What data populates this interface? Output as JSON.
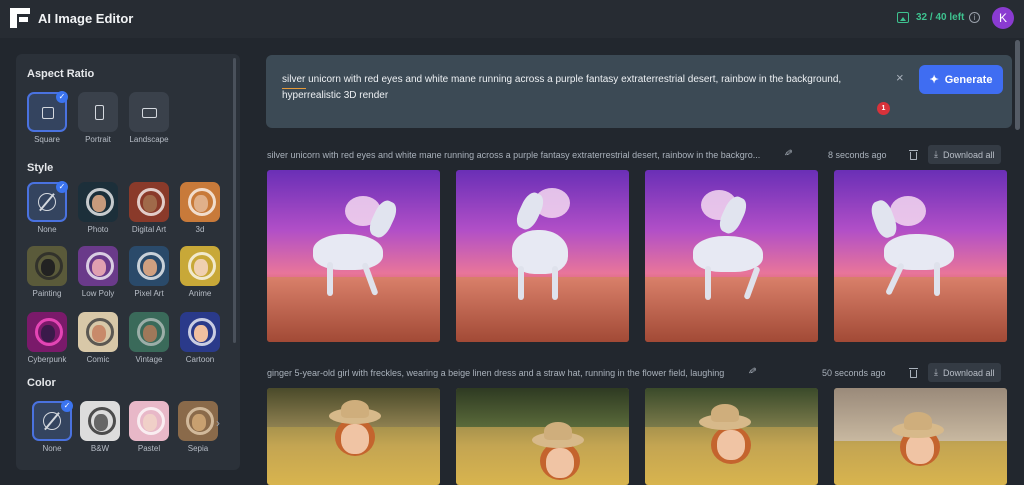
{
  "app": {
    "title": "AI Image Editor",
    "credits": "32 / 40 left",
    "avatar_initial": "K"
  },
  "sidebar": {
    "aspect_ratio": {
      "title": "Aspect Ratio",
      "options": [
        {
          "label": "Square",
          "selected": true,
          "icon": "square-icon"
        },
        {
          "label": "Portrait",
          "selected": false,
          "icon": "portrait-icon"
        },
        {
          "label": "Landscape",
          "selected": false,
          "icon": "landscape-icon"
        }
      ]
    },
    "style": {
      "title": "Style",
      "options": [
        {
          "label": "None",
          "selected": true
        },
        {
          "label": "Photo",
          "selected": false
        },
        {
          "label": "Digital Art",
          "selected": false
        },
        {
          "label": "3d",
          "selected": false
        },
        {
          "label": "Painting",
          "selected": false
        },
        {
          "label": "Low Poly",
          "selected": false
        },
        {
          "label": "Pixel Art",
          "selected": false
        },
        {
          "label": "Anime",
          "selected": false
        },
        {
          "label": "Cyberpunk",
          "selected": false
        },
        {
          "label": "Comic",
          "selected": false
        },
        {
          "label": "Vintage",
          "selected": false
        },
        {
          "label": "Cartoon",
          "selected": false
        }
      ]
    },
    "color": {
      "title": "Color",
      "options": [
        {
          "label": "None",
          "selected": true
        },
        {
          "label": "B&W",
          "selected": false
        },
        {
          "label": "Pastel",
          "selected": false
        },
        {
          "label": "Sepia",
          "selected": false
        }
      ]
    }
  },
  "prompt": {
    "text": "silver unicorn with red eyes and white mane running across a purple fantasy extraterrestrial desert, rainbow in the background, hyperrealistic 3D render",
    "generate_label": "Generate",
    "badge_count": "1"
  },
  "results": [
    {
      "prompt": "silver unicorn with red eyes and white mane running across a purple fantasy extraterrestrial desert, rainbow in the backgro...",
      "time": "8 seconds ago",
      "download_label": "Download all"
    },
    {
      "prompt": "ginger 5-year-old girl with freckles, wearing a beige linen dress and a straw hat, running in the flower field, laughing",
      "time": "50 seconds ago",
      "download_label": "Download all"
    }
  ],
  "colors": {
    "accent": "#3f6df2",
    "credits": "#3ec28f",
    "avatar": "#8a3bd1",
    "badge": "#d8323a"
  }
}
